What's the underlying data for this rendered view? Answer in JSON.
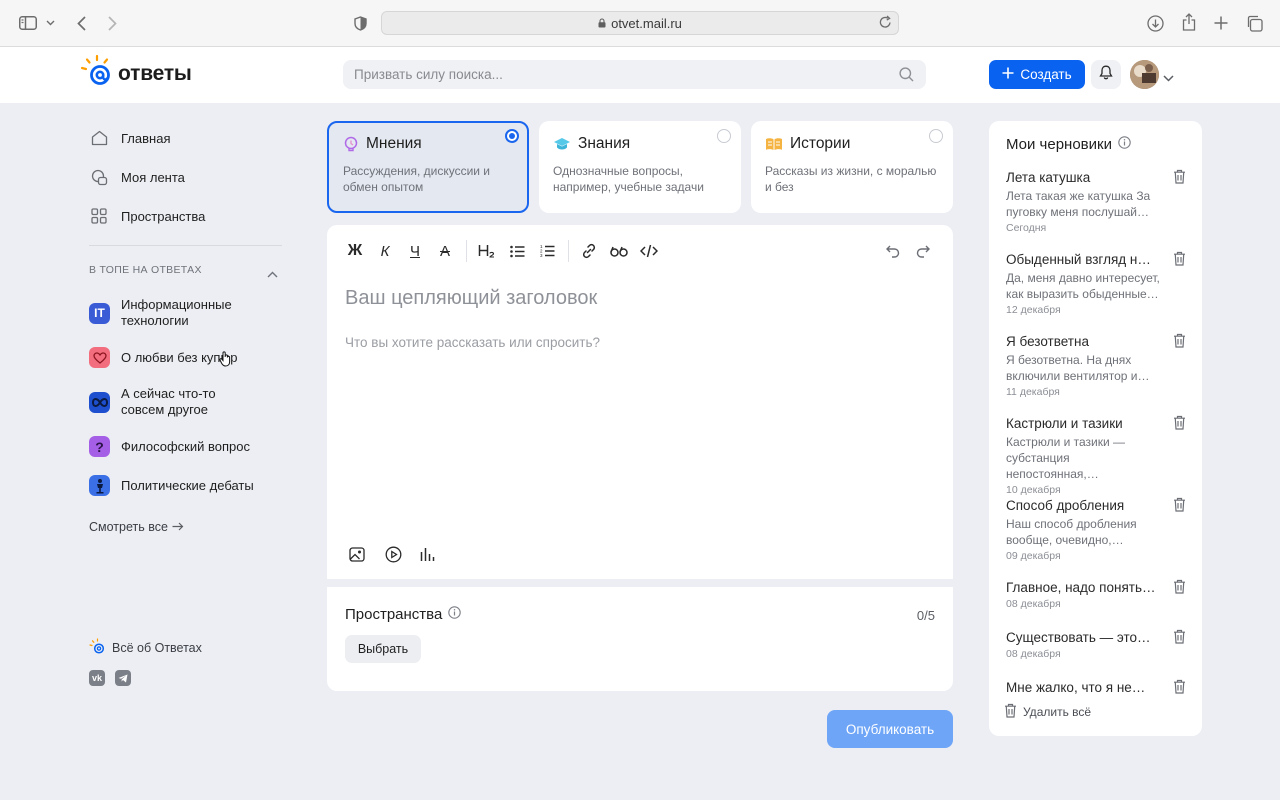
{
  "browser": {
    "url": "otvet.mail.ru"
  },
  "header": {
    "logo_text": "ответы",
    "search_placeholder": "Призвать силу поиска...",
    "create_label": "Создать",
    "accent_color": "#0a63f0"
  },
  "sidebar": {
    "nav": [
      {
        "label": "Главная",
        "icon": "home-icon"
      },
      {
        "label": "Моя лента",
        "icon": "feed-icon"
      },
      {
        "label": "Пространства",
        "icon": "grid-icon"
      }
    ],
    "section_title": "В ТОПЕ НА ОТВЕТАХ",
    "topics": [
      {
        "label": "Информационные технологии",
        "icon": "it-icon",
        "color": "#3a5bd6",
        "glyph": "IT"
      },
      {
        "label": "О любви без купюр",
        "icon": "heart-icon",
        "color": "#f26d7d",
        "glyph": ""
      },
      {
        "label": "А сейчас что-то совсем другое",
        "icon": "infinity-icon",
        "color": "#1d4fcf",
        "glyph": "∞"
      },
      {
        "label": "Философский вопрос",
        "icon": "question-icon",
        "color": "#a55ee6",
        "glyph": "?"
      },
      {
        "label": "Политические дебаты",
        "icon": "podium-icon",
        "color": "#3a6fe6",
        "glyph": ""
      }
    ],
    "see_all": "Смотреть все",
    "about": "Всё об Ответах"
  },
  "types": [
    {
      "title": "Мнения",
      "desc": "Рассуждения, дискуссии и обмен опытом",
      "selected": true
    },
    {
      "title": "Знания",
      "desc": "Однозначные вопросы, например, учебные задачи",
      "selected": false
    },
    {
      "title": "Истории",
      "desc": "Рассказы из жизни, с моралью и без",
      "selected": false
    }
  ],
  "editor": {
    "toolbar": [
      "Ж",
      "К",
      "Ч",
      "A"
    ],
    "title_placeholder": "Ваш цепляющий заголовок",
    "body_placeholder": "Что вы хотите рассказать или спросить?"
  },
  "spaces": {
    "title": "Пространства",
    "count": "0/5",
    "choose_label": "Выбрать"
  },
  "publish_label": "Опубликовать",
  "drafts": {
    "title": "Мои черновики",
    "items": [
      {
        "name": "Лета катушка",
        "text": "Лета такая же катушка За пуговку меня послушай…",
        "date": "Сегодня"
      },
      {
        "name": "Обыденный взгляд на…",
        "text": "Да, меня давно интересует, как выразить обыденные…",
        "date": "12 декабря"
      },
      {
        "name": "Я безответна",
        "text": "Я безответна. На днях включили вентилятор и…",
        "date": "11 декабря"
      },
      {
        "name": "Кастрюли и тазики",
        "text": "Кастрюли и тазики — субстанция непостоянная,…",
        "date": "10 декабря"
      },
      {
        "name": "Способ дробления",
        "text": "Наш способ дробления вообще, очевидно,…",
        "date": "09 декабря"
      },
      {
        "name": "Главное, надо понять,…",
        "text": "",
        "date": "08 декабря"
      },
      {
        "name": "Существовать — это…",
        "text": "",
        "date": "08 декабря"
      },
      {
        "name": "Мне жалко, что я не…",
        "text": "",
        "date": ""
      }
    ],
    "delete_all": "Удалить всё"
  }
}
